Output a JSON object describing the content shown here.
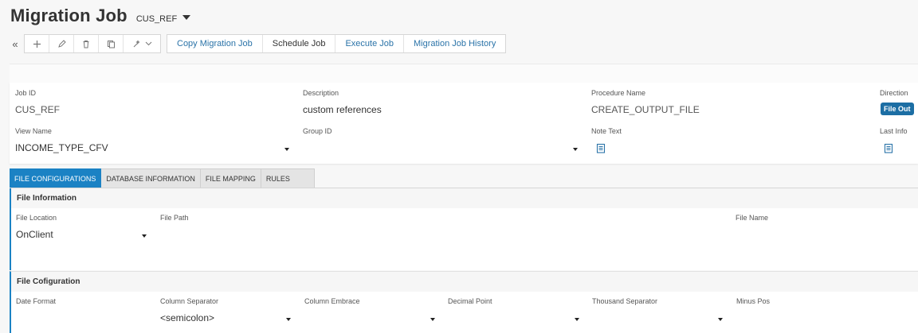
{
  "header": {
    "title": "Migration Job",
    "record_id": "CUS_REF"
  },
  "toolbar": {
    "collapse_icon": "«",
    "actions": [
      "Copy Migration Job",
      "Schedule Job",
      "Execute Job",
      "Migration Job History"
    ]
  },
  "form": {
    "job_id": {
      "label": "Job ID",
      "value": "CUS_REF"
    },
    "description": {
      "label": "Description",
      "value": "custom references"
    },
    "procedure_name": {
      "label": "Procedure Name",
      "value": "CREATE_OUTPUT_FILE"
    },
    "direction": {
      "label": "Direction",
      "value": "File Out"
    },
    "view_name": {
      "label": "View Name",
      "value": "INCOME_TYPE_CFV"
    },
    "group_id": {
      "label": "Group ID",
      "value": ""
    },
    "note_text": {
      "label": "Note Text"
    },
    "last_info": {
      "label": "Last Info"
    }
  },
  "tabs": [
    "FILE CONFIGURATIONS",
    "DATABASE INFORMATION",
    "FILE MAPPING",
    "RULES"
  ],
  "file_information": {
    "title": "File Information",
    "file_location": {
      "label": "File Location",
      "value": "OnClient"
    },
    "file_path": {
      "label": "File Path",
      "value": ""
    },
    "file_name": {
      "label": "File Name",
      "value": ""
    }
  },
  "file_configuration": {
    "title": "File Cofiguration",
    "date_format": {
      "label": "Date Format",
      "value": ""
    },
    "column_separator": {
      "label": "Column Separator",
      "value": "<semicolon>"
    },
    "column_embrace": {
      "label": "Column Embrace",
      "value": ""
    },
    "decimal_point": {
      "label": "Decimal Point",
      "value": ""
    },
    "thousand_separator": {
      "label": "Thousand Separator",
      "value": ""
    },
    "minus_pos": {
      "label": "Minus Pos",
      "value": ""
    }
  },
  "colors": {
    "accent": "#1b82c4",
    "badge": "#1c6ea4",
    "link": "#2a73a8"
  }
}
